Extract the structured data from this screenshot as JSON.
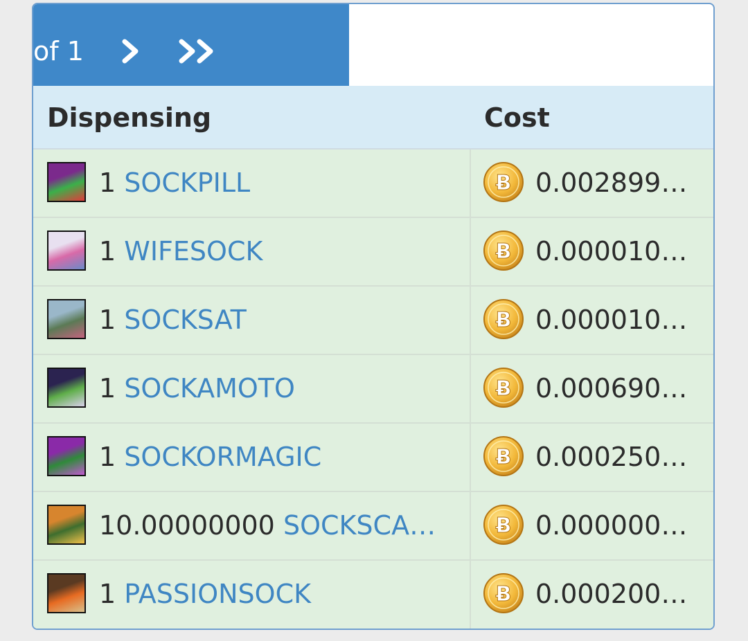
{
  "pager": {
    "of_text": "of 1",
    "next_label": "›",
    "last_label": "»"
  },
  "table": {
    "header_dispensing": "Dispensing",
    "header_cost": "Cost",
    "rows": [
      {
        "qty": "1",
        "asset": "SOCKPILL",
        "price": "0.002899…",
        "thumb_colors": [
          "#7b2a8c",
          "#3bb04a",
          "#e23b3b"
        ]
      },
      {
        "qty": "1",
        "asset": "WIFESOCK",
        "price": "0.000010…",
        "thumb_colors": [
          "#e8e0f0",
          "#d86aa8",
          "#6b8ac8"
        ]
      },
      {
        "qty": "1",
        "asset": "SOCKSAT",
        "price": "0.000010…",
        "thumb_colors": [
          "#9ab7c9",
          "#5b7a55",
          "#c4637e"
        ]
      },
      {
        "qty": "1",
        "asset": "SOCKAMOTO",
        "price": "0.000690…",
        "thumb_colors": [
          "#2b2350",
          "#5fae4a",
          "#d8d0ea"
        ]
      },
      {
        "qty": "1",
        "asset": "SOCKORMAGIC",
        "price": "0.000250…",
        "thumb_colors": [
          "#8a2aa8",
          "#2f8a3a",
          "#c15ad0"
        ]
      },
      {
        "qty": "10.00000000",
        "asset": "SOCKSCA…",
        "price": "0.000000…",
        "thumb_colors": [
          "#d7852e",
          "#3e6e2e",
          "#f2c14a"
        ]
      },
      {
        "qty": "1",
        "asset": "PASSIONSOCK",
        "price": "0.000200…",
        "thumb_colors": [
          "#5a3a22",
          "#e76b22",
          "#d9c08b"
        ]
      }
    ]
  },
  "colors": {
    "pager_bg": "#3f88c9",
    "header_bg": "#d7ebf6",
    "row_bg": "#e0f0df",
    "link": "#3f86c3",
    "coin_gold": "#f2b83a"
  },
  "icons": {
    "next": "chevron-right-icon",
    "last": "double-chevron-right-icon",
    "currency": "bitcoin-icon"
  }
}
